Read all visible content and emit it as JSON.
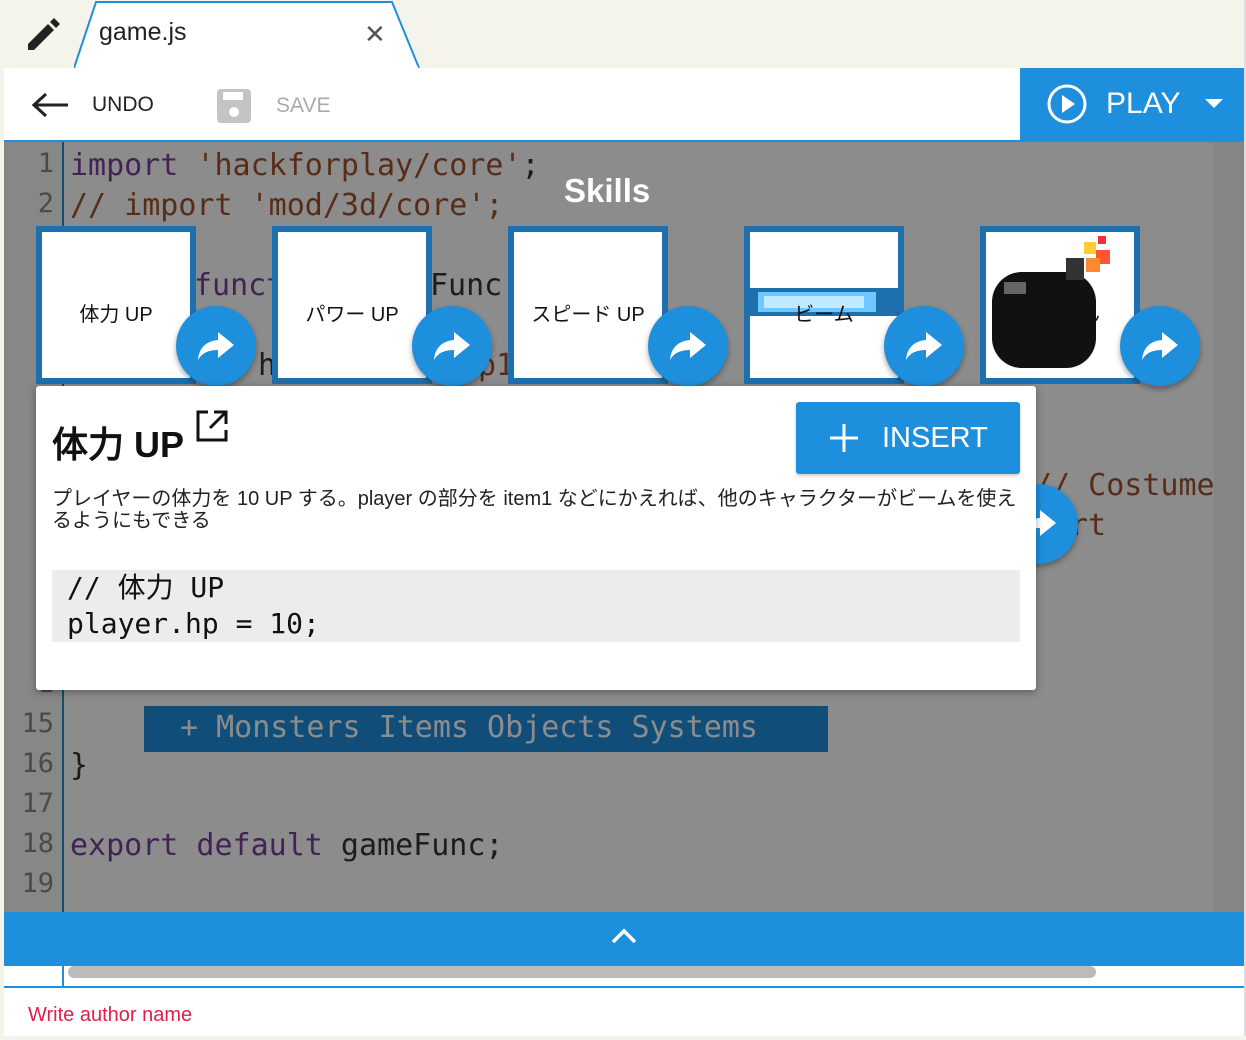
{
  "tab": {
    "filename": "game.js",
    "close_symbol": "✕"
  },
  "toolbar": {
    "undo_label": "UNDO",
    "save_label": "SAVE",
    "play_label": "PLAY"
  },
  "editor": {
    "line_numbers": [
      "1",
      "2",
      "1",
      "1",
      "1",
      "1",
      "1",
      "15",
      "16",
      "17",
      "18",
      "19"
    ],
    "lines": {
      "l1_kw": "import",
      "l1_str": "'hackforplay/core'",
      "l1_end": ";",
      "l2": "// import 'mod/3d/core';",
      "frag_funct": "funct",
      "frag_func": "Func(",
      "frag_h": "h",
      "frag_p1": "p1",
      "frag_costume": "// Costume",
      "frag_rt": "rt",
      "l16": "}",
      "l18_kw": "export default",
      "l18_rest": " gameFunc;"
    },
    "snippet_bar": "+ Monsters Items Objects Systems"
  },
  "skills": {
    "title": "Skills",
    "cards": [
      {
        "label": "体力 UP"
      },
      {
        "label": "パワー UP"
      },
      {
        "label": "スピード UP"
      },
      {
        "label": "ビーム"
      },
      {
        "label": "ばくだん"
      }
    ]
  },
  "detail": {
    "title": "体力 UP",
    "insert_label": "INSERT",
    "description": "プレイヤーの体力を 10 UP する。player の部分を item1 などにかえれば、他のキャラクターがビームを使えるようにもできる",
    "code_line1": "// 体力 UP",
    "code_line2": "player.hp = 10;"
  },
  "footer": {
    "author_placeholder": "Write author name"
  },
  "colors": {
    "accent": "#1e8fdc",
    "card_border": "#1e6fae",
    "author": "#e0204a"
  }
}
